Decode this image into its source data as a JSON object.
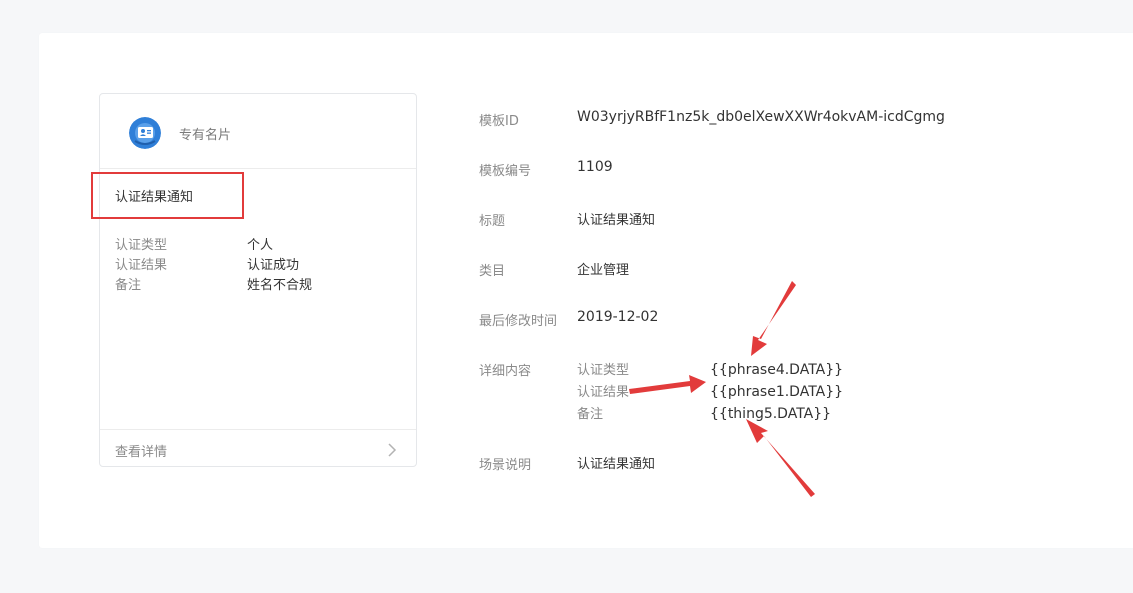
{
  "card": {
    "account_name": "专有名片",
    "title": "认证结果通知",
    "rows": [
      {
        "key": "认证类型",
        "value": "个人"
      },
      {
        "key": "认证结果",
        "value": "认证成功"
      },
      {
        "key": "备注",
        "value": "姓名不合规"
      }
    ],
    "footer_link": "查看详情"
  },
  "details": {
    "template_id_label": "模板ID",
    "template_id_value": "W03yrjyRBfF1nz5k_db0elXewXXWr4okvAM-icdCgmg",
    "template_no_label": "模板编号",
    "template_no_value": "1109",
    "title_label": "标题",
    "title_value": "认证结果通知",
    "category_label": "类目",
    "category_value": "企业管理",
    "modified_label": "最后修改时间",
    "modified_value": "2019-12-02",
    "content_label": "详细内容",
    "content_rows": [
      {
        "key": "认证类型",
        "value": "{{phrase4.DATA}}"
      },
      {
        "key": "认证结果",
        "value": "{{phrase1.DATA}}"
      },
      {
        "key": "备注",
        "value": "{{thing5.DATA}}"
      }
    ],
    "scene_label": "场景说明",
    "scene_value": "认证结果通知"
  },
  "colors": {
    "annotation_red": "#e23b3b",
    "avatar_blue": "#2f7fd8"
  },
  "icons": {
    "avatar": "business-card-icon",
    "footer": "chevron-right-icon"
  }
}
